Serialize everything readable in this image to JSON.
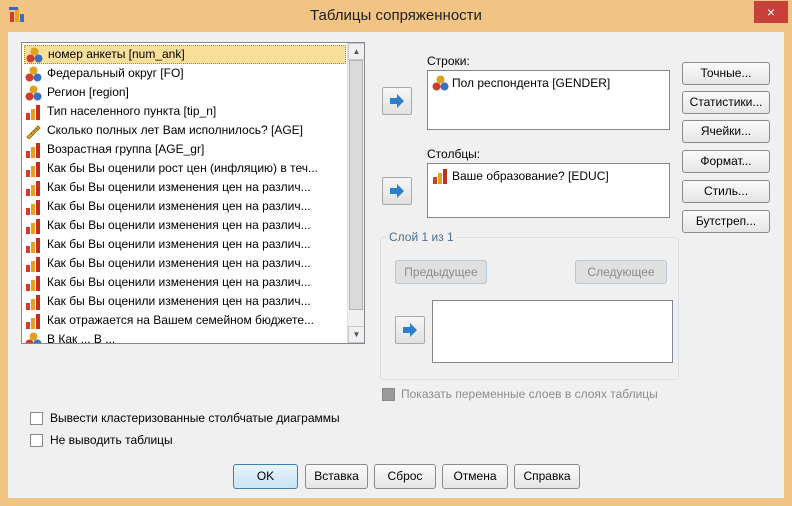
{
  "window": {
    "title": "Таблицы сопряженности",
    "close_label": "×"
  },
  "variables": [
    {
      "label": "номер анкеты [num_ank]",
      "icon": "nominal-icon"
    },
    {
      "label": "Федеральный округ [FO]",
      "icon": "nominal-icon"
    },
    {
      "label": "Регион [region]",
      "icon": "nominal-icon"
    },
    {
      "label": "Тип населенного пункта [tip_n]",
      "icon": "ordinal-icon"
    },
    {
      "label": "Сколько полных лет Вам исполнилось? [AGE]",
      "icon": "scale-icon"
    },
    {
      "label": "Возрастная группа [AGE_gr]",
      "icon": "ordinal-icon"
    },
    {
      "label": "Как бы Вы оценили рост цен (инфляцию) в теч...",
      "icon": "ordinal-icon"
    },
    {
      "label": "Как бы Вы оценили изменения цен на различ...",
      "icon": "ordinal-icon"
    },
    {
      "label": "Как бы Вы оценили изменения цен на различ...",
      "icon": "ordinal-icon"
    },
    {
      "label": "Как бы Вы оценили изменения цен на различ...",
      "icon": "ordinal-icon"
    },
    {
      "label": "Как бы Вы оценили изменения цен на различ...",
      "icon": "ordinal-icon"
    },
    {
      "label": "Как бы Вы оценили изменения цен на различ...",
      "icon": "ordinal-icon"
    },
    {
      "label": "Как бы Вы оценили изменения цен на различ...",
      "icon": "ordinal-icon"
    },
    {
      "label": "Как бы Вы оценили изменения цен на различ...",
      "icon": "ordinal-icon"
    },
    {
      "label": "Как отражается на Вашем семейном бюджете...",
      "icon": "ordinal-icon"
    },
    {
      "label": "В Как ... В ...",
      "icon": "nominal-icon"
    }
  ],
  "rows": {
    "label": "Строки:",
    "item": "Пол респондента [GENDER]"
  },
  "columns": {
    "label": "Столбцы:",
    "item": "Ваше образование? [EDUC]"
  },
  "layer": {
    "legend": "Слой 1 из 1",
    "prev_label": "Предыдущее",
    "next_label": "Следующее"
  },
  "side_buttons": [
    "Точные...",
    "Статистики...",
    "Ячейки...",
    "Формат...",
    "Стиль...",
    "Бутстреп..."
  ],
  "options": {
    "show_layers_label": "Показать переменные слоев в слоях таблицы",
    "clustered_bars_label": "Вывести кластеризованные столбчатые диаграммы",
    "suppress_tables_label": "Не выводить таблицы"
  },
  "bottom_buttons": {
    "ok": "OK",
    "paste": "Вставка",
    "reset": "Сброс",
    "cancel": "Отмена",
    "help": "Справка"
  },
  "colors": {
    "titlebar": "#f2c484",
    "close": "#c7403a",
    "selected_row": "#f8e09a"
  }
}
